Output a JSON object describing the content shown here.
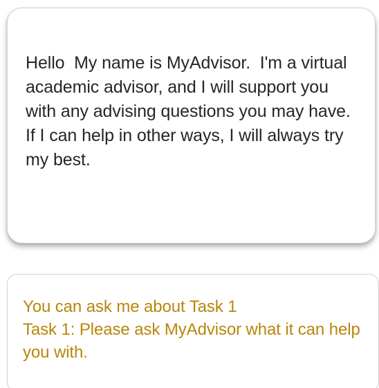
{
  "advisor_message": {
    "text": "Hello  My name is MyAdvisor.  I'm a virtual academic advisor, and I will support you with any advising questions you may have. If I can help in other ways, I will always try my best."
  },
  "task_prompt": {
    "line1": "You can ask me about Task 1",
    "line2": "Task 1: Please ask MyAdvisor what it can help you with."
  },
  "colors": {
    "message_text": "#262626",
    "task_text": "#b8860b",
    "bubble_border": "#d4d4d4"
  }
}
